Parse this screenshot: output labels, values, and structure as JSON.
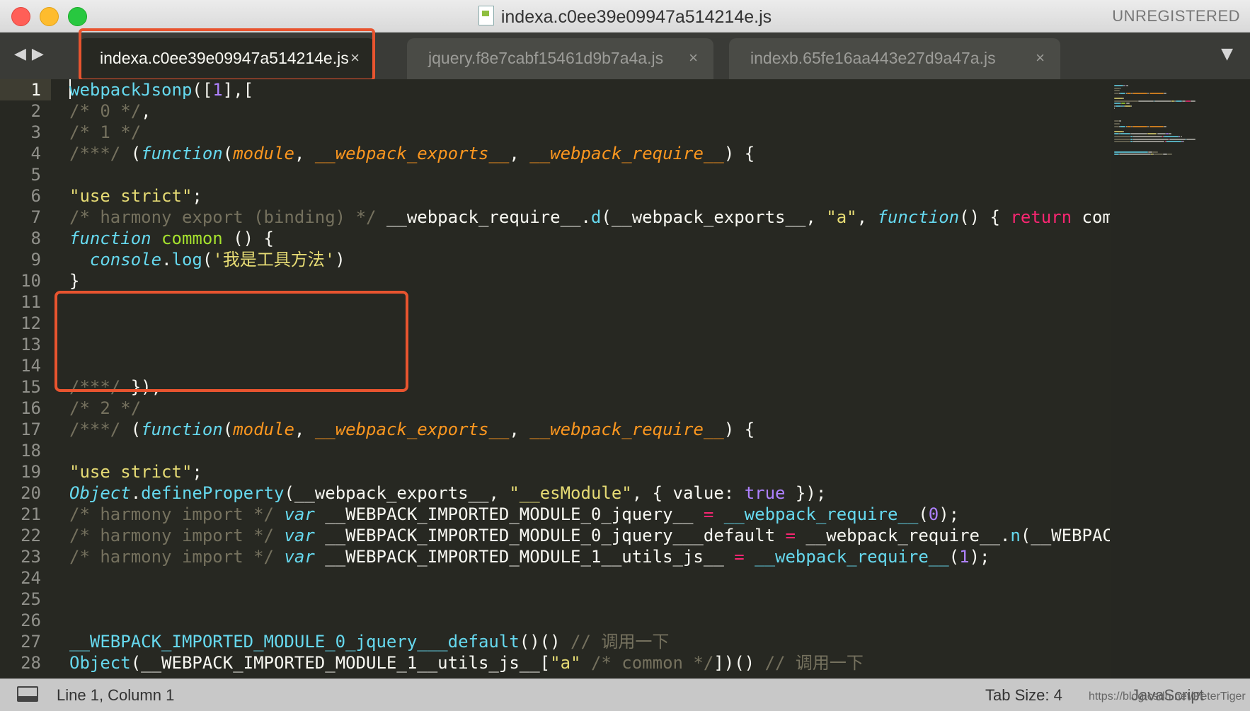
{
  "window": {
    "title": "indexa.c0ee39e09947a514214e.js",
    "registration": "UNREGISTERED"
  },
  "tabs": [
    {
      "label": "indexa.c0ee39e09947a514214e.js",
      "close": "×",
      "active": true
    },
    {
      "label": "jquery.f8e7cabf15461d9b7a4a.js",
      "close": "×",
      "active": false
    },
    {
      "label": "indexb.65fe16aa443e27d9a47a.js",
      "close": "×",
      "active": false
    }
  ],
  "nav": {
    "back": "◀",
    "forward": "▶",
    "tab_menu": "▼"
  },
  "status": {
    "position": "Line 1, Column 1",
    "tab_size": "Tab Size: 4",
    "syntax": "JavaScript",
    "watermark": "https://blog.csdn.net/PeterTiger"
  },
  "colors": {
    "highlight_box": "#e8542f",
    "editor_bg": "#272822",
    "comment": "#75715e",
    "string": "#e6db74",
    "keyword": "#66d9ef",
    "operator": "#f92672",
    "function_name": "#a6e22e",
    "param": "#fd971f",
    "number": "#ae81ff"
  },
  "code": {
    "line_numbers": [
      "1",
      "2",
      "3",
      "4",
      "5",
      "6",
      "7",
      "8",
      "9",
      "10",
      "11",
      "12",
      "13",
      "14",
      "15",
      "16",
      "17",
      "18",
      "19",
      "20",
      "21",
      "22",
      "23",
      "24",
      "25",
      "26",
      "27",
      "28"
    ],
    "lines": [
      [
        {
          "t": "webpackJsonp",
          "c": "c-call"
        },
        {
          "t": "([",
          "c": "c-plain"
        },
        {
          "t": "1",
          "c": "c-num"
        },
        {
          "t": "],[",
          "c": "c-plain"
        }
      ],
      [
        {
          "t": "/* 0 */",
          "c": "c-comment"
        },
        {
          "t": ",",
          "c": "c-plain"
        }
      ],
      [
        {
          "t": "/* 1 */",
          "c": "c-comment"
        }
      ],
      [
        {
          "t": "/***/ ",
          "c": "c-comment"
        },
        {
          "t": "(",
          "c": "c-plain"
        },
        {
          "t": "function",
          "c": "c-kw"
        },
        {
          "t": "(",
          "c": "c-plain"
        },
        {
          "t": "module",
          "c": "c-param"
        },
        {
          "t": ", ",
          "c": "c-plain"
        },
        {
          "t": "__webpack_exports__",
          "c": "c-param"
        },
        {
          "t": ", ",
          "c": "c-plain"
        },
        {
          "t": "__webpack_require__",
          "c": "c-param"
        },
        {
          "t": ") {",
          "c": "c-plain"
        }
      ],
      [],
      [
        {
          "t": "\"use strict\"",
          "c": "c-str"
        },
        {
          "t": ";",
          "c": "c-plain"
        }
      ],
      [
        {
          "t": "/* harmony export (binding) */ ",
          "c": "c-comment"
        },
        {
          "t": "__webpack_require__.",
          "c": "c-plain"
        },
        {
          "t": "d",
          "c": "c-call"
        },
        {
          "t": "(__webpack_exports__, ",
          "c": "c-plain"
        },
        {
          "t": "\"a\"",
          "c": "c-str"
        },
        {
          "t": ", ",
          "c": "c-plain"
        },
        {
          "t": "function",
          "c": "c-kw"
        },
        {
          "t": "() { ",
          "c": "c-plain"
        },
        {
          "t": "return",
          "c": "c-op"
        },
        {
          "t": " common",
          "c": "c-plain"
        }
      ],
      [
        {
          "t": "function",
          "c": "c-kw"
        },
        {
          "t": " ",
          "c": "c-plain"
        },
        {
          "t": "common",
          "c": "c-func"
        },
        {
          "t": " () {",
          "c": "c-plain"
        }
      ],
      [
        {
          "t": "  ",
          "c": "c-plain"
        },
        {
          "t": "console",
          "c": "c-kw"
        },
        {
          "t": ".",
          "c": "c-plain"
        },
        {
          "t": "log",
          "c": "c-call"
        },
        {
          "t": "(",
          "c": "c-plain"
        },
        {
          "t": "'我是工具方法'",
          "c": "c-str"
        },
        {
          "t": ")",
          "c": "c-plain"
        }
      ],
      [
        {
          "t": "}",
          "c": "c-plain"
        }
      ],
      [],
      [],
      [],
      [],
      [
        {
          "t": "/***/ ",
          "c": "c-comment"
        },
        {
          "t": "}),",
          "c": "c-plain"
        }
      ],
      [
        {
          "t": "/* 2 */",
          "c": "c-comment"
        }
      ],
      [
        {
          "t": "/***/ ",
          "c": "c-comment"
        },
        {
          "t": "(",
          "c": "c-plain"
        },
        {
          "t": "function",
          "c": "c-kw"
        },
        {
          "t": "(",
          "c": "c-plain"
        },
        {
          "t": "module",
          "c": "c-param"
        },
        {
          "t": ", ",
          "c": "c-plain"
        },
        {
          "t": "__webpack_exports__",
          "c": "c-param"
        },
        {
          "t": ", ",
          "c": "c-plain"
        },
        {
          "t": "__webpack_require__",
          "c": "c-param"
        },
        {
          "t": ") {",
          "c": "c-plain"
        }
      ],
      [],
      [
        {
          "t": "\"use strict\"",
          "c": "c-str"
        },
        {
          "t": ";",
          "c": "c-plain"
        }
      ],
      [
        {
          "t": "Object",
          "c": "c-kw"
        },
        {
          "t": ".",
          "c": "c-plain"
        },
        {
          "t": "defineProperty",
          "c": "c-call"
        },
        {
          "t": "(__webpack_exports__, ",
          "c": "c-plain"
        },
        {
          "t": "\"__esModule\"",
          "c": "c-str"
        },
        {
          "t": ", { value: ",
          "c": "c-plain"
        },
        {
          "t": "true",
          "c": "c-num"
        },
        {
          "t": " });",
          "c": "c-plain"
        }
      ],
      [
        {
          "t": "/* harmony import */ ",
          "c": "c-comment"
        },
        {
          "t": "var",
          "c": "c-kw"
        },
        {
          "t": " __WEBPACK_IMPORTED_MODULE_0_jquery__ ",
          "c": "c-plain"
        },
        {
          "t": "=",
          "c": "c-op"
        },
        {
          "t": " ",
          "c": "c-plain"
        },
        {
          "t": "__webpack_require__",
          "c": "c-call"
        },
        {
          "t": "(",
          "c": "c-plain"
        },
        {
          "t": "0",
          "c": "c-num"
        },
        {
          "t": ");",
          "c": "c-plain"
        }
      ],
      [
        {
          "t": "/* harmony import */ ",
          "c": "c-comment"
        },
        {
          "t": "var",
          "c": "c-kw"
        },
        {
          "t": " __WEBPACK_IMPORTED_MODULE_0_jquery___default ",
          "c": "c-plain"
        },
        {
          "t": "=",
          "c": "c-op"
        },
        {
          "t": " __webpack_require__.",
          "c": "c-plain"
        },
        {
          "t": "n",
          "c": "c-call"
        },
        {
          "t": "(__WEBPACK_I",
          "c": "c-plain"
        }
      ],
      [
        {
          "t": "/* harmony import */ ",
          "c": "c-comment"
        },
        {
          "t": "var",
          "c": "c-kw"
        },
        {
          "t": " __WEBPACK_IMPORTED_MODULE_1__utils_js__ ",
          "c": "c-plain"
        },
        {
          "t": "=",
          "c": "c-op"
        },
        {
          "t": " ",
          "c": "c-plain"
        },
        {
          "t": "__webpack_require__",
          "c": "c-call"
        },
        {
          "t": "(",
          "c": "c-plain"
        },
        {
          "t": "1",
          "c": "c-num"
        },
        {
          "t": ");",
          "c": "c-plain"
        }
      ],
      [],
      [],
      [],
      [
        {
          "t": "__WEBPACK_IMPORTED_MODULE_0_jquery___default",
          "c": "c-call"
        },
        {
          "t": "()() ",
          "c": "c-plain"
        },
        {
          "t": "// 调用一下",
          "c": "c-comment"
        }
      ],
      [
        {
          "t": "Object",
          "c": "c-call"
        },
        {
          "t": "(__WEBPACK_IMPORTED_MODULE_1__utils_js__[",
          "c": "c-plain"
        },
        {
          "t": "\"a\"",
          "c": "c-str"
        },
        {
          "t": " ",
          "c": "c-plain"
        },
        {
          "t": "/* common */",
          "c": "c-comment"
        },
        {
          "t": "])() ",
          "c": "c-plain"
        },
        {
          "t": "// 调用一下",
          "c": "c-comment"
        }
      ]
    ]
  }
}
